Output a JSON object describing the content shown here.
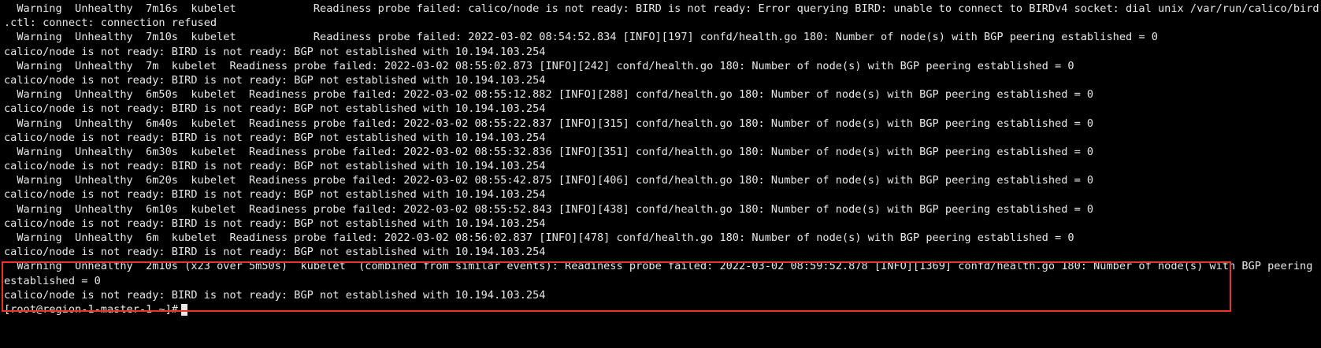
{
  "terminal": {
    "lines": [
      "  Warning  Unhealthy  7m16s  kubelet            Readiness probe failed: calico/node is not ready: BIRD is not ready: Error querying BIRD: unable to connect to BIRDv4 socket: dial unix /var/run/calico/bird",
      ".ctl: connect: connection refused",
      "  Warning  Unhealthy  7m10s  kubelet            Readiness probe failed: 2022-03-02 08:54:52.834 [INFO][197] confd/health.go 180: Number of node(s) with BGP peering established = 0",
      "calico/node is not ready: BIRD is not ready: BGP not established with 10.194.103.254",
      "  Warning  Unhealthy  7m  kubelet  Readiness probe failed: 2022-03-02 08:55:02.873 [INFO][242] confd/health.go 180: Number of node(s) with BGP peering established = 0",
      "calico/node is not ready: BIRD is not ready: BGP not established with 10.194.103.254",
      "  Warning  Unhealthy  6m50s  kubelet  Readiness probe failed: 2022-03-02 08:55:12.882 [INFO][288] confd/health.go 180: Number of node(s) with BGP peering established = 0",
      "calico/node is not ready: BIRD is not ready: BGP not established with 10.194.103.254",
      "  Warning  Unhealthy  6m40s  kubelet  Readiness probe failed: 2022-03-02 08:55:22.837 [INFO][315] confd/health.go 180: Number of node(s) with BGP peering established = 0",
      "calico/node is not ready: BIRD is not ready: BGP not established with 10.194.103.254",
      "  Warning  Unhealthy  6m30s  kubelet  Readiness probe failed: 2022-03-02 08:55:32.836 [INFO][351] confd/health.go 180: Number of node(s) with BGP peering established = 0",
      "calico/node is not ready: BIRD is not ready: BGP not established with 10.194.103.254",
      "  Warning  Unhealthy  6m20s  kubelet  Readiness probe failed: 2022-03-02 08:55:42.875 [INFO][406] confd/health.go 180: Number of node(s) with BGP peering established = 0",
      "calico/node is not ready: BIRD is not ready: BGP not established with 10.194.103.254",
      "  Warning  Unhealthy  6m10s  kubelet  Readiness probe failed: 2022-03-02 08:55:52.843 [INFO][438] confd/health.go 180: Number of node(s) with BGP peering established = 0",
      "calico/node is not ready: BIRD is not ready: BGP not established with 10.194.103.254",
      "  Warning  Unhealthy  6m  kubelet  Readiness probe failed: 2022-03-02 08:56:02.837 [INFO][478] confd/health.go 180: Number of node(s) with BGP peering established = 0",
      "calico/node is not ready: BIRD is not ready: BGP not established with 10.194.103.254",
      "  Warning  Unhealthy  2m10s (x23 over 5m50s)  kubelet  (combined from similar events): Readiness probe failed: 2022-03-02 08:59:52.878 [INFO][1369] confd/health.go 180: Number of node(s) with BGP peering",
      "established = 0",
      "calico/node is not ready: BIRD is not ready: BGP not established with 10.194.103.254"
    ],
    "prompt": "[root@region-1-master-1 ~]#",
    "highlight_color": "#e8352b",
    "text_color": "#e8e8e8",
    "background_color": "#000000"
  }
}
